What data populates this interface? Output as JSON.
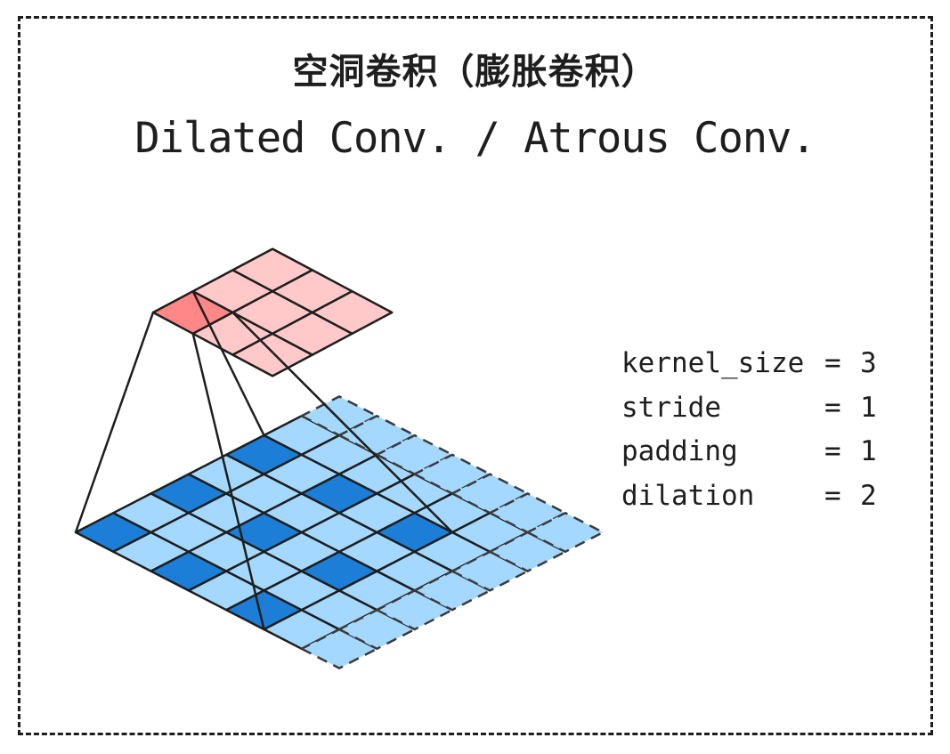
{
  "title": {
    "zh": "空洞卷积（膨胀卷积）",
    "en": "Dilated Conv. / Atrous Conv."
  },
  "params": [
    {
      "name": "kernel_size",
      "value": "3"
    },
    {
      "name": "stride",
      "value": "1"
    },
    {
      "name": "padding",
      "value": "1"
    },
    {
      "name": "dilation",
      "value": "2"
    }
  ],
  "colors": {
    "ink": "#1e1e1e",
    "input_light": "#a5d8ff",
    "input_active": "#1c7ed6",
    "output_light": "#ffc9c9",
    "output_active": "#ff8787"
  }
}
